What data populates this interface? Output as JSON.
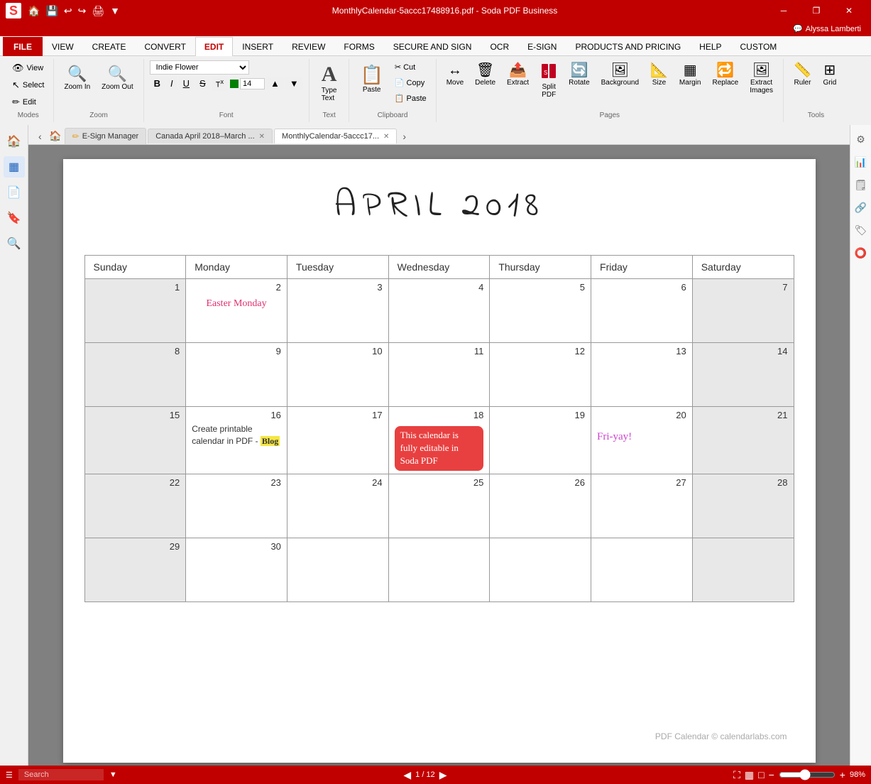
{
  "titleBar": {
    "title": "MonthlyCalendar-5accc17488916.pdf  -  Soda PDF Business",
    "closeLabel": "✕",
    "minimizeLabel": "─",
    "maximizeLabel": "□",
    "restoreLabel": "❐"
  },
  "ribbon": {
    "tabs": [
      "FILE",
      "VIEW",
      "CREATE",
      "CONVERT",
      "EDIT",
      "INSERT",
      "REVIEW",
      "FORMS",
      "SECURE AND SIGN",
      "OCR",
      "E-SIGN",
      "PRODUCTS AND PRICING",
      "HELP",
      "CUSTOM"
    ],
    "activeTab": "EDIT",
    "user": "Alyssa Lamberti",
    "modes": {
      "label": "Modes",
      "items": [
        "View",
        "Select",
        "Edit"
      ]
    },
    "zoom": {
      "label": "Zoom",
      "zoomIn": "🔍+",
      "zoomOut": "🔍-"
    },
    "font": {
      "label": "Font",
      "current": "Indie Flower",
      "size": "14"
    },
    "text": {
      "label": "Text",
      "typeText": "Type Text"
    },
    "clipboard": {
      "label": "Clipboard",
      "cut": "Cut",
      "copy": "Copy",
      "paste": "Paste"
    },
    "pages": {
      "label": "Pages",
      "move": "Move",
      "delete": "Delete",
      "extract": "Extract",
      "splitPDF": "Split PDF",
      "rotate": "Rotate",
      "background": "Background",
      "size": "Size",
      "margin": "Margin",
      "replace": "Replace",
      "extractImages": "Extract Images"
    },
    "tools": {
      "label": "Tools",
      "ruler": "Ruler",
      "grid": "Grid"
    }
  },
  "tabs": {
    "items": [
      {
        "label": "E-Sign Manager",
        "icon": "✏️",
        "closeable": false,
        "active": false
      },
      {
        "label": "Canada April 2018–March ...",
        "icon": "",
        "closeable": true,
        "active": false
      },
      {
        "label": "MonthlyCalendar-5accc17...",
        "icon": "",
        "closeable": true,
        "active": true
      }
    ]
  },
  "document": {
    "title": "APRIL  2018",
    "headers": [
      "Sunday",
      "Monday",
      "Tuesday",
      "Wednesday",
      "Thursday",
      "Friday",
      "Saturday"
    ],
    "weeks": [
      [
        {
          "day": "1",
          "gray": true,
          "content": ""
        },
        {
          "day": "2",
          "gray": false,
          "content": "easter_monday"
        },
        {
          "day": "3",
          "gray": false,
          "content": ""
        },
        {
          "day": "4",
          "gray": false,
          "content": ""
        },
        {
          "day": "5",
          "gray": false,
          "content": ""
        },
        {
          "day": "6",
          "gray": false,
          "content": ""
        },
        {
          "day": "7",
          "gray": true,
          "content": ""
        }
      ],
      [
        {
          "day": "8",
          "gray": true,
          "content": ""
        },
        {
          "day": "9",
          "gray": false,
          "content": ""
        },
        {
          "day": "10",
          "gray": false,
          "content": ""
        },
        {
          "day": "11",
          "gray": false,
          "content": ""
        },
        {
          "day": "12",
          "gray": false,
          "content": ""
        },
        {
          "day": "13",
          "gray": false,
          "content": ""
        },
        {
          "day": "14",
          "gray": true,
          "content": ""
        }
      ],
      [
        {
          "day": "15",
          "gray": true,
          "content": ""
        },
        {
          "day": "16",
          "gray": false,
          "content": "blog"
        },
        {
          "day": "17",
          "gray": false,
          "content": ""
        },
        {
          "day": "18",
          "gray": false,
          "content": "red_note"
        },
        {
          "day": "19",
          "gray": false,
          "content": ""
        },
        {
          "day": "20",
          "gray": false,
          "content": "friyay"
        },
        {
          "day": "21",
          "gray": true,
          "content": ""
        }
      ],
      [
        {
          "day": "22",
          "gray": true,
          "content": ""
        },
        {
          "day": "23",
          "gray": false,
          "content": ""
        },
        {
          "day": "24",
          "gray": false,
          "content": ""
        },
        {
          "day": "25",
          "gray": false,
          "content": ""
        },
        {
          "day": "26",
          "gray": false,
          "content": ""
        },
        {
          "day": "27",
          "gray": false,
          "content": ""
        },
        {
          "day": "28",
          "gray": true,
          "content": ""
        }
      ],
      [
        {
          "day": "29",
          "gray": true,
          "content": ""
        },
        {
          "day": "30",
          "gray": false,
          "content": ""
        },
        {
          "day": "",
          "gray": false,
          "content": ""
        },
        {
          "day": "",
          "gray": false,
          "content": ""
        },
        {
          "day": "",
          "gray": false,
          "content": ""
        },
        {
          "day": "",
          "gray": false,
          "content": ""
        },
        {
          "day": "",
          "gray": true,
          "content": ""
        }
      ]
    ],
    "annotations": {
      "easter_monday": "Easter Monday",
      "blog_text": "Create printable calendar in PDF - Blog",
      "red_note": "This calendar is fully editable in Soda PDF",
      "friyay": "Fri-yay!"
    },
    "footer": "PDF Calendar © calendarlabs.com"
  },
  "statusBar": {
    "searchPlaceholder": "Search",
    "pageInfo": "1  /  12",
    "zoomLevel": "98%"
  },
  "sidebar": {
    "left": [
      "🏠",
      "📋",
      "📄",
      "🔖",
      "🔍"
    ],
    "right": [
      "⚙",
      "📊",
      "🗒",
      "🔗",
      "🏷",
      "⭕"
    ]
  }
}
